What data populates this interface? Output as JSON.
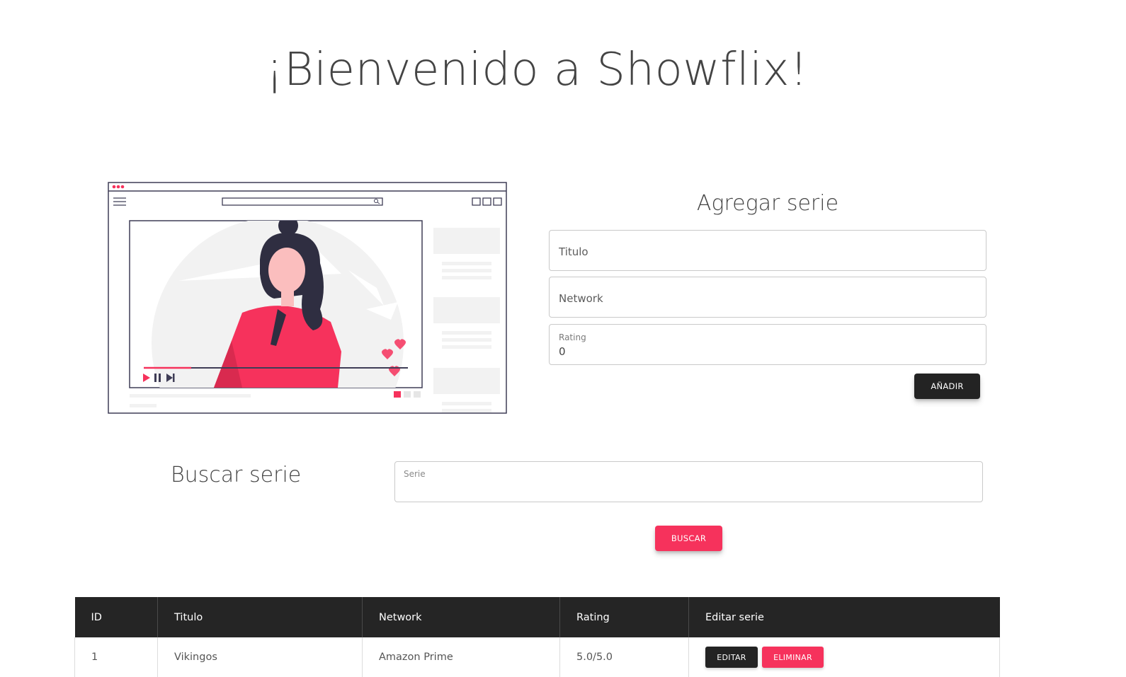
{
  "page": {
    "title": "¡Bienvenido a Showflix!"
  },
  "add_form": {
    "title": "Agregar serie",
    "titulo_placeholder": "Titulo",
    "network_placeholder": "Network",
    "rating_label": "Rating",
    "rating_value": "0",
    "add_button": "AÑADIR"
  },
  "search": {
    "title": "Buscar serie",
    "field_label": "Serie",
    "field_value": "",
    "button": "BUSCAR"
  },
  "table": {
    "headers": [
      "ID",
      "Titulo",
      "Network",
      "Rating",
      "Editar serie"
    ],
    "rows": [
      {
        "id": "1",
        "titulo": "Vikingos",
        "network": "Amazon Prime",
        "rating": "5.0/5.0",
        "edit": "EDITAR",
        "delete": "ELIMINAR"
      }
    ]
  },
  "colors": {
    "accent": "#f6325c",
    "dark": "#232323",
    "illustration_skin": "#fbbebe",
    "illustration_hair": "#2f2e41"
  },
  "icons": [
    "play-icon",
    "pause-icon",
    "skip-icon",
    "menu-icon",
    "search-icon",
    "heart-icon"
  ]
}
